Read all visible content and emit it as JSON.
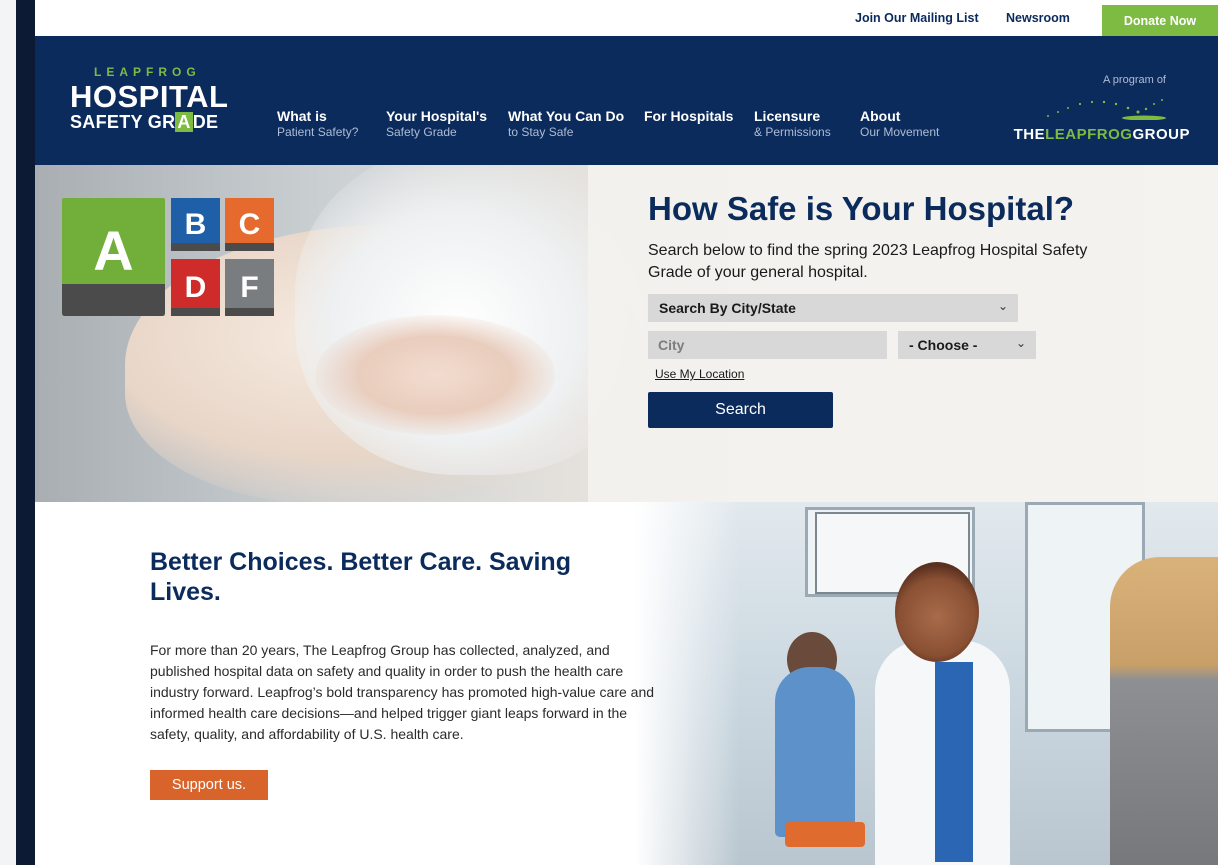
{
  "utility_bar": {
    "mailing_list": "Join Our Mailing List",
    "newsroom": "Newsroom",
    "donate": "Donate Now"
  },
  "logo": {
    "top": "LEAPFROG",
    "middle": "HOSPITAL",
    "bottom_pre": "SAFETY GR",
    "bottom_box": "A",
    "bottom_post": "DE"
  },
  "nav": [
    {
      "main": "What is",
      "sub": "Patient Safety?"
    },
    {
      "main": "Your Hospital's",
      "sub": "Safety Grade"
    },
    {
      "main": "What You Can Do",
      "sub": "to Stay Safe"
    },
    {
      "main": "For Hospitals",
      "sub": ""
    },
    {
      "main": "Licensure",
      "sub": "& Permissions"
    },
    {
      "main": "About",
      "sub": "Our Movement"
    }
  ],
  "program": {
    "label": "A program of",
    "name_white": "THE",
    "name_green": "LEAPFROG",
    "name_white2": "GROUP"
  },
  "grade_logo": {
    "tiles": [
      "A",
      "B",
      "C",
      "D",
      "F"
    ]
  },
  "hero": {
    "title": "How Safe is Your Hospital?",
    "description": "Search below to find the spring 2023 Leapfrog Hospital Safety Grade of your general hospital.",
    "search_mode": "Search By City/State",
    "city_placeholder": "City",
    "state_selected": "- Choose -",
    "use_location": "Use My Location",
    "search_button": "Search"
  },
  "content": {
    "title": "Better Choices. Better Care. Saving Lives.",
    "body": "For more than 20 years, The Leapfrog Group has collected, analyzed, and published hospital data on safety and quality in order to push the health care industry forward. Leapfrog’s bold transparency has promoted high-value care and informed health care decisions—and helped trigger giant leaps forward in the safety, quality, and affordability of U.S. health care.",
    "support_button": "Support us."
  },
  "colors": {
    "navy": "#0b2b5c",
    "green": "#7dbb42",
    "orange": "#d9642b"
  }
}
